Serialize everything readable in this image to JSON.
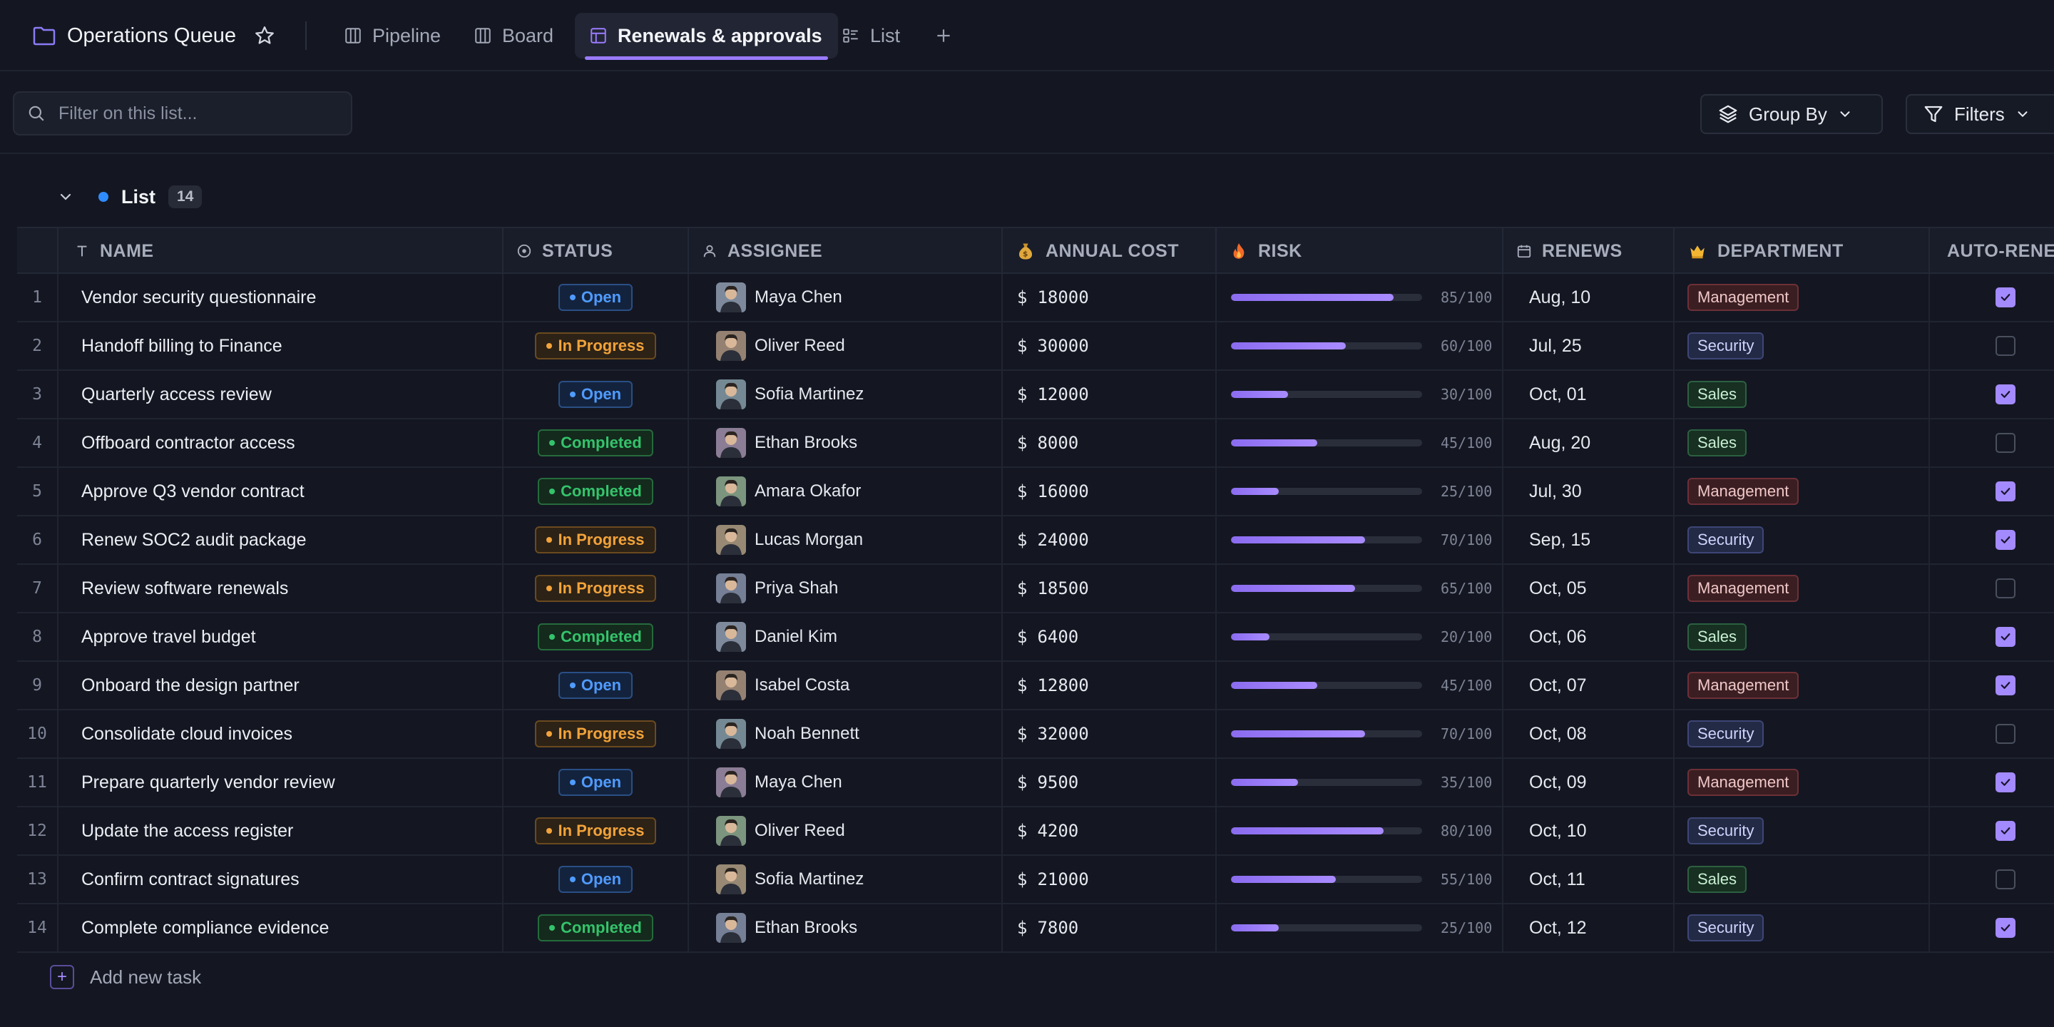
{
  "workspace": {
    "title": "Operations Queue"
  },
  "tabs": [
    {
      "label": "Pipeline"
    },
    {
      "label": "Board"
    },
    {
      "label": "Renewals & approvals",
      "active": true
    },
    {
      "label": "List"
    }
  ],
  "toolbar": {
    "search_placeholder": "Filter on this list...",
    "group_by_label": "Group By",
    "filters_label": "Filters"
  },
  "list": {
    "title": "List",
    "count": "14"
  },
  "columns": {
    "name": "NAME",
    "status": "STATUS",
    "assignee": "ASSIGNEE",
    "cost": "ANNUAL COST",
    "risk": "RISK",
    "renews": "RENEWS",
    "department": "DEPARTMENT",
    "auto": "AUTO-RENE"
  },
  "colors": {
    "accent": "#9b7bff",
    "open": "#4f9bff",
    "in_progress": "#f2a33a",
    "completed": "#34c36b"
  },
  "rows": [
    {
      "idx": "1",
      "name": "Vendor security questionnaire",
      "status": "Open",
      "assignee": "Maya Chen",
      "cost": "18000",
      "risk": 85,
      "risk_label": "85/100",
      "renews": "Aug, 10",
      "dept": "Management",
      "auto": true
    },
    {
      "idx": "2",
      "name": "Handoff billing to Finance",
      "status": "In Progress",
      "assignee": "Oliver Reed",
      "cost": "30000",
      "risk": 60,
      "risk_label": "60/100",
      "renews": "Jul, 25",
      "dept": "Security",
      "auto": false
    },
    {
      "idx": "3",
      "name": "Quarterly access review",
      "status": "Open",
      "assignee": "Sofia Martinez",
      "cost": "12000",
      "risk": 30,
      "risk_label": "30/100",
      "renews": "Oct, 01",
      "dept": "Sales",
      "auto": true
    },
    {
      "idx": "4",
      "name": "Offboard contractor access",
      "status": "Completed",
      "assignee": "Ethan Brooks",
      "cost": "8000",
      "risk": 45,
      "risk_label": "45/100",
      "renews": "Aug, 20",
      "dept": "Sales",
      "auto": false
    },
    {
      "idx": "5",
      "name": "Approve Q3 vendor contract",
      "status": "Completed",
      "assignee": "Amara Okafor",
      "cost": "16000",
      "risk": 25,
      "risk_label": "25/100",
      "renews": "Jul, 30",
      "dept": "Management",
      "auto": true
    },
    {
      "idx": "6",
      "name": "Renew SOC2 audit package",
      "status": "In Progress",
      "assignee": "Lucas Morgan",
      "cost": "24000",
      "risk": 70,
      "risk_label": "70/100",
      "renews": "Sep, 15",
      "dept": "Security",
      "auto": true
    },
    {
      "idx": "7",
      "name": "Review software renewals",
      "status": "In Progress",
      "assignee": "Priya Shah",
      "cost": "18500",
      "risk": 65,
      "risk_label": "65/100",
      "renews": "Oct, 05",
      "dept": "Management",
      "auto": false
    },
    {
      "idx": "8",
      "name": "Approve travel budget",
      "status": "Completed",
      "assignee": "Daniel Kim",
      "cost": "6400",
      "risk": 20,
      "risk_label": "20/100",
      "renews": "Oct, 06",
      "dept": "Sales",
      "auto": true
    },
    {
      "idx": "9",
      "name": "Onboard the design partner",
      "status": "Open",
      "assignee": "Isabel Costa",
      "cost": "12800",
      "risk": 45,
      "risk_label": "45/100",
      "renews": "Oct, 07",
      "dept": "Management",
      "auto": true
    },
    {
      "idx": "10",
      "name": "Consolidate cloud invoices",
      "status": "In Progress",
      "assignee": "Noah Bennett",
      "cost": "32000",
      "risk": 70,
      "risk_label": "70/100",
      "renews": "Oct, 08",
      "dept": "Security",
      "auto": false
    },
    {
      "idx": "11",
      "name": "Prepare quarterly vendor review",
      "status": "Open",
      "assignee": "Maya Chen",
      "cost": "9500",
      "risk": 35,
      "risk_label": "35/100",
      "renews": "Oct, 09",
      "dept": "Management",
      "auto": true
    },
    {
      "idx": "12",
      "name": "Update the access register",
      "status": "In Progress",
      "assignee": "Oliver Reed",
      "cost": "4200",
      "risk": 80,
      "risk_label": "80/100",
      "renews": "Oct, 10",
      "dept": "Security",
      "auto": true
    },
    {
      "idx": "13",
      "name": "Confirm contract signatures",
      "status": "Open",
      "assignee": "Sofia Martinez",
      "cost": "21000",
      "risk": 55,
      "risk_label": "55/100",
      "renews": "Oct, 11",
      "dept": "Sales",
      "auto": false
    },
    {
      "idx": "14",
      "name": "Complete compliance evidence",
      "status": "Completed",
      "assignee": "Ethan Brooks",
      "cost": "7800",
      "risk": 25,
      "risk_label": "25/100",
      "renews": "Oct, 12",
      "dept": "Security",
      "auto": true
    }
  ],
  "currency_symbol": "$",
  "footer": {
    "add_label": "Add new task",
    "add_symbol": "+"
  }
}
